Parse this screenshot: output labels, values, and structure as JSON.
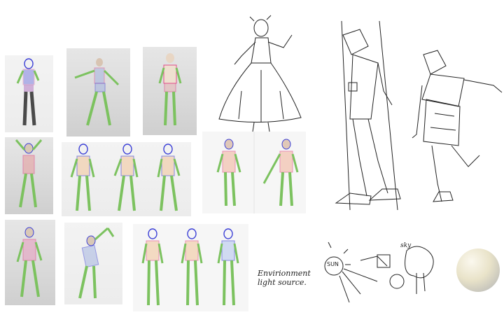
{
  "board": {
    "env_note": "Envirionment\nlight source.",
    "sun_label": "SUN",
    "sky_label": "sky"
  },
  "colors": {
    "head": "#3b3fd6",
    "torso": "#e14c8a",
    "limb": "#7cc25f",
    "joint": "#f0892a"
  }
}
